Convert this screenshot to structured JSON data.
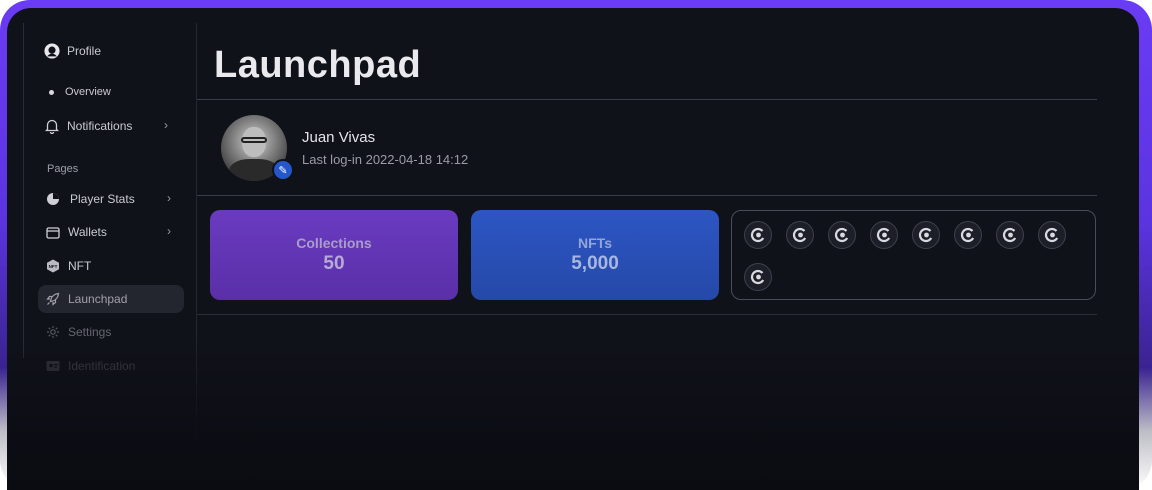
{
  "sidebar": {
    "profile_label": "Profile",
    "overview_label": "Overview",
    "notifications_label": "Notifications",
    "section_label": "Pages",
    "items": [
      {
        "label": "Player Stats",
        "icon": "pie-chart-icon"
      },
      {
        "label": "Wallets",
        "icon": "wallet-icon"
      },
      {
        "label": "NFT",
        "icon": "nft-icon"
      },
      {
        "label": "Launchpad",
        "icon": "rocket-icon"
      },
      {
        "label": "Settings",
        "icon": "gear-icon"
      },
      {
        "label": "Identification",
        "icon": "id-card-icon"
      }
    ]
  },
  "main": {
    "title": "Launchpad",
    "user": {
      "name": "Juan Vivas",
      "last_login": "Last log-in 2022-04-18 14:12"
    },
    "stats": [
      {
        "label": "Collections",
        "value": "50"
      },
      {
        "label": "NFTs",
        "value": "5,000"
      }
    ],
    "token_icon": "coin-icon"
  },
  "colors": {
    "frame_accent": "#6a3cf5",
    "background": "#10121a",
    "collections_card": "#6a3bc0",
    "nfts_card": "#2d56c4",
    "avatar_badge": "#2457c9"
  }
}
